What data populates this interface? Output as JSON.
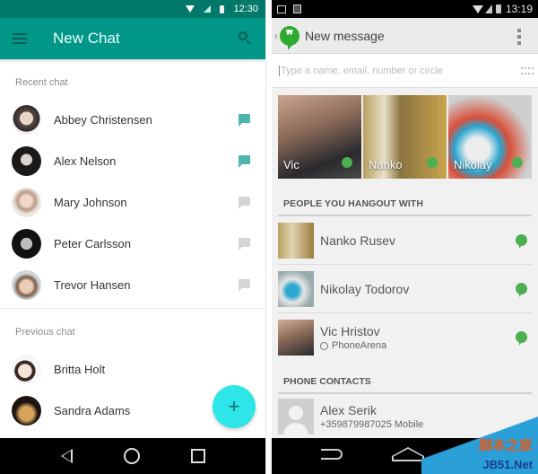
{
  "left": {
    "status": {
      "time": "12:30"
    },
    "appbar": {
      "title": "New Chat",
      "menu_icon": "hamburger-icon",
      "search_icon": "search-icon"
    },
    "recent": {
      "label": "Recent chat",
      "items": [
        {
          "name": "Abbey Christensen",
          "unread": true
        },
        {
          "name": "Alex Nelson",
          "unread": true
        },
        {
          "name": "Mary Johnson",
          "unread": false
        },
        {
          "name": "Peter Carlsson",
          "unread": false
        },
        {
          "name": "Trevor Hansen",
          "unread": false
        }
      ]
    },
    "previous": {
      "label": "Previous chat",
      "items": [
        {
          "name": "Britta Holt"
        },
        {
          "name": "Sandra Adams"
        }
      ]
    },
    "fab": {
      "label": "+"
    },
    "colors": {
      "primary": "#009688",
      "primary_dark": "#00796b",
      "accent": "#2ee6e8"
    }
  },
  "right": {
    "status": {
      "time": "13:19"
    },
    "appbar": {
      "back": "‹",
      "logo": "❞",
      "title": "New message"
    },
    "input": {
      "placeholder": "Type a name, email, number or circle"
    },
    "tiles": [
      {
        "name": "Vic",
        "online": true
      },
      {
        "name": "Nanko",
        "online": true
      },
      {
        "name": "Nikolay",
        "online": true
      }
    ],
    "hangout_section": {
      "label": "PEOPLE YOU HANGOUT WITH",
      "items": [
        {
          "name": "Nanko Rusev",
          "sub": ""
        },
        {
          "name": "Nikolay Todorov",
          "sub": ""
        },
        {
          "name": "Vic Hristov",
          "sub": "PhoneArena"
        }
      ]
    },
    "contacts_section": {
      "label": "PHONE CONTACTS",
      "items": [
        {
          "name": "Alex Serik",
          "sub": "+359879987025 Mobile"
        }
      ]
    },
    "colors": {
      "hangouts_green": "#2eaa2e",
      "presence": "#4caf50"
    }
  },
  "watermark": {
    "line1": "脚本之家",
    "line2": "JB51.Net"
  }
}
